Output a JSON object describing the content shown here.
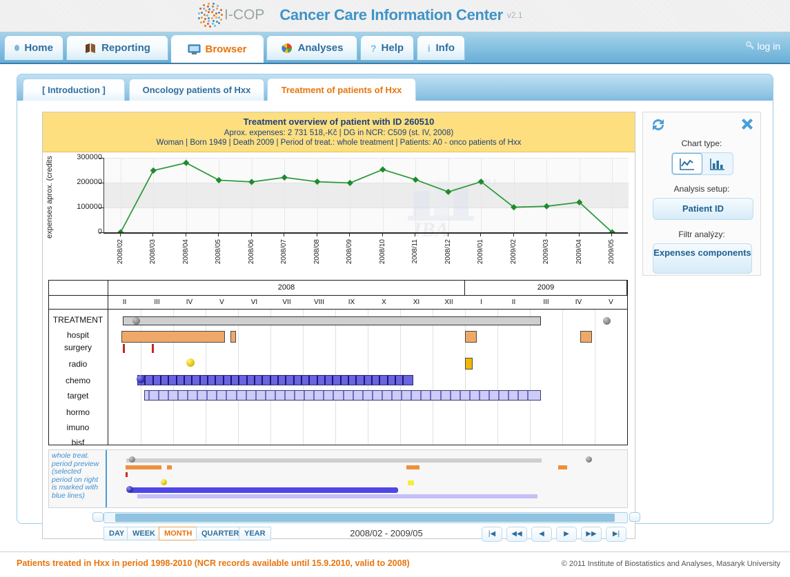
{
  "brand": {
    "logo_name": "icop-logo",
    "logo_text": "I-COP",
    "app_title": "Cancer Care Information Center",
    "version": "v2.1"
  },
  "nav": {
    "tabs": [
      {
        "label": "Home",
        "icon": "bullet-icon",
        "active": false
      },
      {
        "label": "Reporting",
        "icon": "book-icon",
        "active": false
      },
      {
        "label": "Browser",
        "icon": "monitor-icon",
        "active": true
      },
      {
        "label": "Analyses",
        "icon": "piechart-icon",
        "active": false
      },
      {
        "label": "Help",
        "icon": "question-icon",
        "active": false
      },
      {
        "label": "Info",
        "icon": "info-icon",
        "active": false
      }
    ],
    "login_label": "log in",
    "login_icon": "key-icon"
  },
  "subtabs": [
    {
      "label": "[ Introduction ]",
      "active": false
    },
    {
      "label": "Oncology patients of Hxx",
      "active": false
    },
    {
      "label": "Treatment of patients of Hxx",
      "active": true
    }
  ],
  "card": {
    "title": "Treatment overview of patient with ID 260510",
    "line2": "Aprox. expenses: 2 731 518,-Kč | DG in NCR: C509 (st. IV, 2008)",
    "line3": "Woman | Born 1949 | Death 2009 | Period of treat.: whole treatment | Patients: A0 - onco patients of Hxx",
    "watermark": "IBA MU"
  },
  "chart_data": {
    "type": "line",
    "title": "Treatment overview of patient with ID 260510",
    "xlabel": "",
    "ylabel": "expenses aprox. (credits",
    "ylim": [
      0,
      300000
    ],
    "yticks": [
      0,
      100000,
      200000,
      300000
    ],
    "grid": true,
    "legend": "none",
    "series_color": "#2e9b3a",
    "categories": [
      "2008/02",
      "2008/03",
      "2008/04",
      "2008/05",
      "2008/06",
      "2008/07",
      "2008/08",
      "2008/09",
      "2008/10",
      "2008/11",
      "2008/12",
      "2009/01",
      "2009/02",
      "2009/03",
      "2009/04",
      "2009/05"
    ],
    "values": [
      0,
      249000,
      280000,
      210000,
      203000,
      221000,
      204000,
      199000,
      253000,
      212000,
      163000,
      204000,
      101000,
      105000,
      121000,
      0
    ]
  },
  "sidebar": {
    "refresh_icon": "refresh-icon",
    "close_icon": "close-icon",
    "chart_type_label": "Chart type:",
    "chart_type_options": [
      {
        "name": "line-chart-icon",
        "selected": true
      },
      {
        "name": "bar-chart-icon",
        "selected": false
      }
    ],
    "analysis_setup_label": "Analysis setup:",
    "analysis_setup_button": "Patient ID",
    "filter_label": "Filtr analýzy:",
    "filter_button": "Expenses components"
  },
  "timeline": {
    "years": [
      {
        "label": "2008",
        "months": 11
      },
      {
        "label": "2009",
        "months": 5
      }
    ],
    "months": [
      "II",
      "III",
      "IV",
      "V",
      "VI",
      "VII",
      "VIII",
      "IX",
      "X",
      "XI",
      "XII",
      "I",
      "II",
      "III",
      "IV",
      "V"
    ],
    "rows": [
      "TREATMENT",
      "hospit",
      "surgery",
      "radio",
      "chemo",
      "target",
      "hormo",
      "imuno",
      "bisf"
    ]
  },
  "preview": {
    "caption": "whole treat. period preview (selected period on right is marked with blue lines)"
  },
  "controls": {
    "granularity": [
      {
        "label": "DAY",
        "selected": false
      },
      {
        "label": "WEEK",
        "selected": false
      },
      {
        "label": "MONTH",
        "selected": true
      },
      {
        "label": "QUARTER",
        "selected": false
      },
      {
        "label": "YEAR",
        "selected": false
      }
    ],
    "range_text": "2008/02 - 2009/05",
    "nav_buttons": [
      "first-page-icon",
      "fast-rewind-icon",
      "prev-icon",
      "next-icon",
      "fast-forward-icon",
      "last-page-icon"
    ]
  },
  "footer": {
    "left": "Patients treated in Hxx in period 1998-2010 (NCR records available until 15.9.2010, valid to 2008)",
    "right": "© 2011 Institute of Biostatistics and Analyses, Masaryk University"
  },
  "colors": {
    "accent_orange": "#e8740c",
    "accent_blue": "#2e6e9e",
    "series_green": "#2e9b3a",
    "header_yellow": "#fddf80"
  }
}
